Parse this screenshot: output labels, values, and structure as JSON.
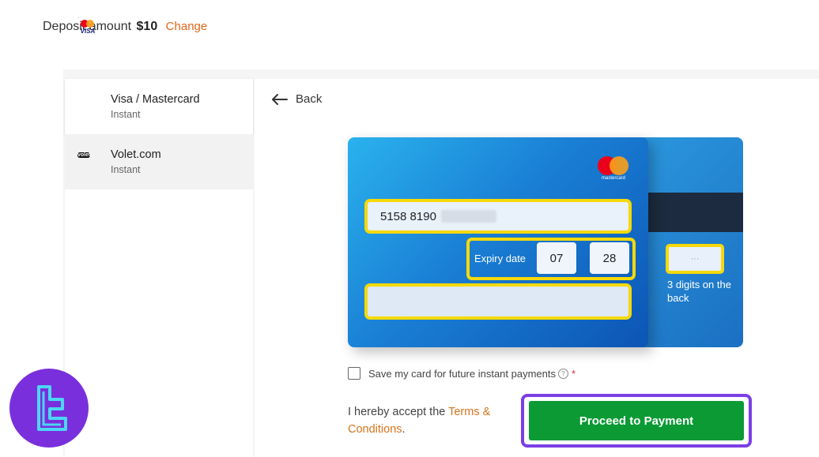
{
  "header": {
    "deposit_label": "Deposit amount",
    "deposit_amount": "$10",
    "change_label": "Change"
  },
  "sidebar": {
    "methods": [
      {
        "name": "Visa / Mastercard",
        "sub": "Instant",
        "logo": "visa-mastercard-logo"
      },
      {
        "name": "Volet.com",
        "sub": "Instant",
        "logo": "volet-logo",
        "logo_text": "volet"
      }
    ]
  },
  "main": {
    "back_label": "Back",
    "card": {
      "brand_text": "mastercard",
      "number_visible": "5158 8190",
      "expiry_label": "Expiry date",
      "expiry_month": "07",
      "expiry_year": "28",
      "cvv_placeholder": "···",
      "cvv_hint": "3 digits on the back"
    },
    "save_card_label": "Save my card for future instant payments",
    "help_icon": "?",
    "required_mark": "*",
    "terms_prefix": "I hereby accept the",
    "terms_link": "Terms & Conditions",
    "terms_suffix": ".",
    "proceed_label": "Proceed to Payment"
  },
  "colors": {
    "accent_orange": "#e2661a",
    "proceed_green": "#0c9a35",
    "highlight_yellow": "#f5d90a",
    "highlight_purple": "#7b3fe4"
  }
}
